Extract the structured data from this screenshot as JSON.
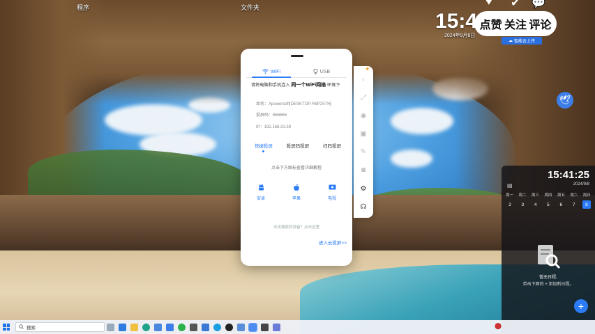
{
  "desktop": {
    "icon_labels": [
      "程序",
      "文件夹"
    ]
  },
  "clock_overlay": {
    "time": "15:4",
    "date": "2024年9月8日"
  },
  "social": {
    "like": "点赞",
    "follow": "关注",
    "comment": "评论",
    "tag": "智能云上传"
  },
  "app": {
    "tabs": [
      {
        "label": "WiFi",
        "icon": "wifi-icon",
        "active": true
      },
      {
        "label": "USB",
        "icon": "usb-icon",
        "active": false
      }
    ],
    "instruction_prefix": "请将电脑和手机连入",
    "instruction_bold": "同一个WiFi网络",
    "instruction_suffix": "环境下",
    "device_label": "本机：",
    "device_value": "Apowersoft[DESKTOP-R8P25TH]",
    "code_label": "投屏码：",
    "code_value": "666666",
    "ip_label": "IP：",
    "ip_value": "192.168.31.59",
    "modes": [
      {
        "label": "快捷投屏",
        "active": true
      },
      {
        "label": "投屏码投屏",
        "active": false
      },
      {
        "label": "扫码投屏",
        "active": false
      }
    ],
    "hint": "点击下方图标查看详细教程",
    "os_options": [
      {
        "label": "安卓",
        "icon": "android-icon"
      },
      {
        "label": "苹果",
        "icon": "apple-icon"
      },
      {
        "label": "电视",
        "icon": "tv-icon"
      }
    ],
    "help_link": "无法搜索到设备？点击这里",
    "cloud_link": "进入云投屏>>",
    "accent": "#2b7cf6"
  },
  "sidebar_icons": [
    "star-icon",
    "chevron-left-icon",
    "fullscreen-icon",
    "record-icon",
    "screenshot-icon",
    "pen-icon",
    "camera-icon",
    "settings-icon",
    "support-icon"
  ],
  "calendar": {
    "time": "15:41:25",
    "date": "2024/9/8",
    "weekdays": [
      "周一",
      "周二",
      "周三",
      "周四",
      "周五",
      "周六",
      "周日"
    ],
    "days": [
      "2",
      "3",
      "4",
      "5",
      "6",
      "7",
      "8"
    ],
    "today": "8",
    "empty_title": "暂无日程,",
    "empty_sub": "单击下面的 + 添加新日程。",
    "add_label": "+"
  },
  "taskbar": {
    "search_placeholder": "搜索"
  }
}
